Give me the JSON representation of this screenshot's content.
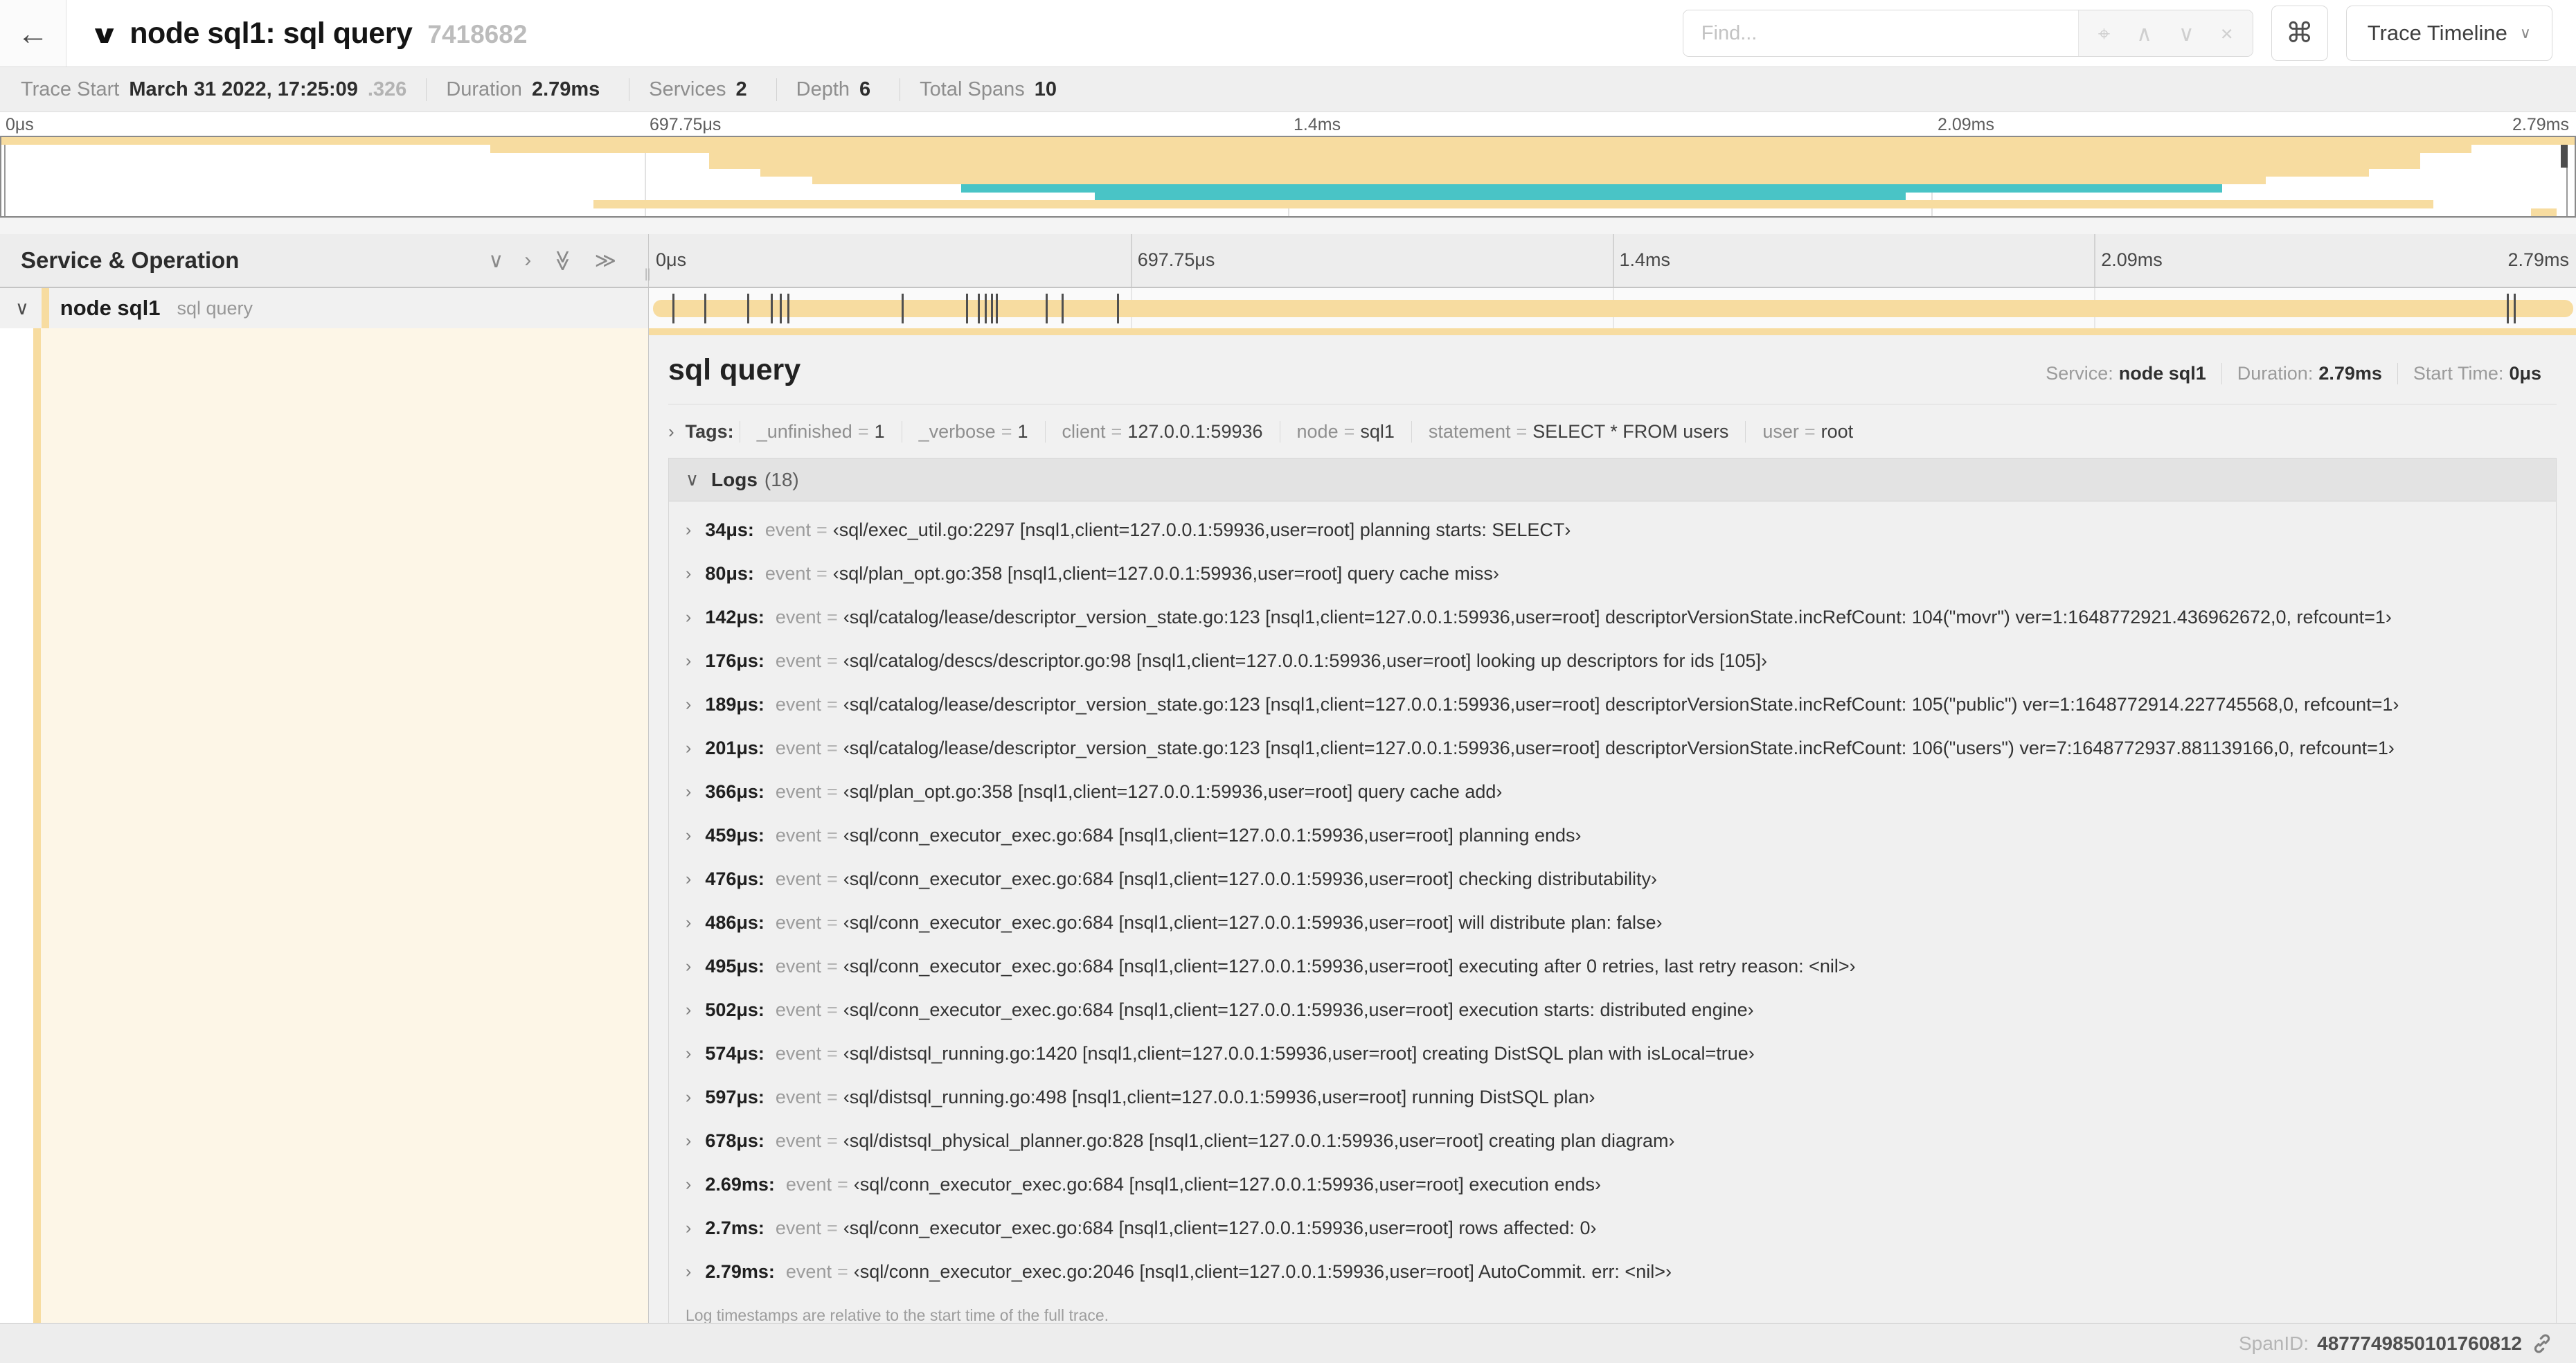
{
  "icons": {
    "back": "←",
    "title_collapse": "∨",
    "target": "⌖",
    "prev": "∧",
    "next": "∨",
    "clear": "×",
    "command": "⌘",
    "select_chevron": "∨",
    "collapse_one": "∨",
    "expand_one": "›",
    "collapse_all": "≫",
    "expand_all": "≫",
    "row_chevron": "∨",
    "tags_chevron": "›",
    "logs_chevron": "∨",
    "log_chevron": "›"
  },
  "header": {
    "title": "node sql1: sql query",
    "trace_id": "7418682",
    "find_placeholder": "Find...",
    "view_select_label": "Trace Timeline"
  },
  "summary": {
    "items": [
      {
        "label": "Trace Start",
        "value": "March 31 2022, 17:25:09",
        "suffix": ".326"
      },
      {
        "label": "Duration",
        "value": "2.79ms",
        "suffix": ""
      },
      {
        "label": "Services",
        "value": "2",
        "suffix": ""
      },
      {
        "label": "Depth",
        "value": "6",
        "suffix": ""
      },
      {
        "label": "Total Spans",
        "value": "10",
        "suffix": ""
      }
    ],
    "duration_label": "2.79ms"
  },
  "timeline": {
    "ticks": [
      "0μs",
      "697.75μs",
      "1.4ms",
      "2.09ms",
      "2.79ms"
    ],
    "tick_pcts": [
      0,
      25,
      50,
      75,
      100
    ]
  },
  "minimap": {
    "spans": [
      {
        "start": 0,
        "end": 100,
        "color": "tan"
      },
      {
        "start": 19,
        "end": 96,
        "color": "tan"
      },
      {
        "start": 27.5,
        "end": 94,
        "color": "tan"
      },
      {
        "start": 27.5,
        "end": 94,
        "color": "tan"
      },
      {
        "start": 29.5,
        "end": 92,
        "color": "tan"
      },
      {
        "start": 31.5,
        "end": 88,
        "color": "tan"
      },
      {
        "start": 37.3,
        "end": 86.3,
        "color": "teal"
      },
      {
        "start": 42.5,
        "end": 74,
        "color": "teal"
      },
      {
        "start": 23,
        "end": 94.5,
        "color": "tan"
      },
      {
        "start": 98.3,
        "end": 99.3,
        "color": "tan"
      }
    ]
  },
  "table": {
    "column_title": "Service & Operation"
  },
  "span_row": {
    "service": "node sql1",
    "operation": "sql query"
  },
  "detail": {
    "title": "sql query",
    "meta": [
      {
        "label": "Service:",
        "value": "node sql1"
      },
      {
        "label": "Duration:",
        "value": "2.79ms"
      },
      {
        "label": "Start Time:",
        "value": "0μs"
      }
    ],
    "tags_label": "Tags:",
    "tag_eq": "=",
    "tags": [
      {
        "key": "_unfinished",
        "value": "1"
      },
      {
        "key": "_verbose",
        "value": "1"
      },
      {
        "key": "client",
        "value": "127.0.0.1:59936"
      },
      {
        "key": "node",
        "value": "sql1"
      },
      {
        "key": "statement",
        "value": "SELECT * FROM users"
      },
      {
        "key": "user",
        "value": "root"
      }
    ],
    "logs_label": "Logs",
    "logs_count": "(18)",
    "log_field": "event",
    "log_eq": "=",
    "logs": [
      {
        "time": "34μs:",
        "value": "‹sql/exec_util.go:2297 [nsql1,client=127.0.0.1:59936,user=root] planning starts: SELECT›"
      },
      {
        "time": "80μs:",
        "value": "‹sql/plan_opt.go:358 [nsql1,client=127.0.0.1:59936,user=root] query cache miss›"
      },
      {
        "time": "142μs:",
        "value": "‹sql/catalog/lease/descriptor_version_state.go:123 [nsql1,client=127.0.0.1:59936,user=root] descriptorVersionState.incRefCount: 104(\"movr\") ver=1:1648772921.436962672,0, refcount=1›"
      },
      {
        "time": "176μs:",
        "value": "‹sql/catalog/descs/descriptor.go:98 [nsql1,client=127.0.0.1:59936,user=root] looking up descriptors for ids [105]›"
      },
      {
        "time": "189μs:",
        "value": "‹sql/catalog/lease/descriptor_version_state.go:123 [nsql1,client=127.0.0.1:59936,user=root] descriptorVersionState.incRefCount: 105(\"public\") ver=1:1648772914.227745568,0, refcount=1›"
      },
      {
        "time": "201μs:",
        "value": "‹sql/catalog/lease/descriptor_version_state.go:123 [nsql1,client=127.0.0.1:59936,user=root] descriptorVersionState.incRefCount: 106(\"users\") ver=7:1648772937.881139166,0, refcount=1›"
      },
      {
        "time": "366μs:",
        "value": "‹sql/plan_opt.go:358 [nsql1,client=127.0.0.1:59936,user=root] query cache add›"
      },
      {
        "time": "459μs:",
        "value": "‹sql/conn_executor_exec.go:684 [nsql1,client=127.0.0.1:59936,user=root] planning ends›"
      },
      {
        "time": "476μs:",
        "value": "‹sql/conn_executor_exec.go:684 [nsql1,client=127.0.0.1:59936,user=root] checking distributability›"
      },
      {
        "time": "486μs:",
        "value": "‹sql/conn_executor_exec.go:684 [nsql1,client=127.0.0.1:59936,user=root] will distribute plan: false›"
      },
      {
        "time": "495μs:",
        "value": "‹sql/conn_executor_exec.go:684 [nsql1,client=127.0.0.1:59936,user=root] executing after 0 retries, last retry reason: <nil>›"
      },
      {
        "time": "502μs:",
        "value": "‹sql/conn_executor_exec.go:684 [nsql1,client=127.0.0.1:59936,user=root] execution starts: distributed engine›"
      },
      {
        "time": "574μs:",
        "value": "‹sql/distsql_running.go:1420 [nsql1,client=127.0.0.1:59936,user=root] creating DistSQL plan with isLocal=true›"
      },
      {
        "time": "597μs:",
        "value": "‹sql/distsql_running.go:498 [nsql1,client=127.0.0.1:59936,user=root] running DistSQL plan›"
      },
      {
        "time": "678μs:",
        "value": "‹sql/distsql_physical_planner.go:828 [nsql1,client=127.0.0.1:59936,user=root] creating plan diagram›"
      },
      {
        "time": "2.69ms:",
        "value": "‹sql/conn_executor_exec.go:684 [nsql1,client=127.0.0.1:59936,user=root] execution ends›"
      },
      {
        "time": "2.7ms:",
        "value": "‹sql/conn_executor_exec.go:684 [nsql1,client=127.0.0.1:59936,user=root] rows affected: 0›"
      },
      {
        "time": "2.79ms:",
        "value": "‹sql/conn_executor_exec.go:2046 [nsql1,client=127.0.0.1:59936,user=root] AutoCommit. err: <nil>›"
      }
    ],
    "footer_note": "Log timestamps are relative to the start time of the full trace."
  },
  "footer": {
    "span_id_label": "SpanID:",
    "span_id": "4877749850101760812"
  },
  "colors": {
    "span_tan": "#F7DCA0",
    "span_teal": "#49C4C6",
    "detail_row_tint": "rgba(247,220,160,0.25)"
  }
}
